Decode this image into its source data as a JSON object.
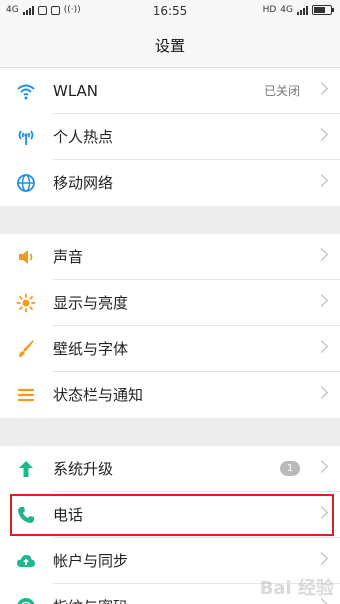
{
  "status_bar": {
    "network_left": "4G",
    "time": "16:55",
    "network_right_hd": "HD",
    "network_right_4g": "4G",
    "battery_level": 0.7
  },
  "header": {
    "title": "设置"
  },
  "groups": [
    {
      "items": [
        {
          "name": "wlan",
          "label": "WLAN",
          "icon": "wifi-icon",
          "color": "#1e90e6",
          "value": "已关闭"
        },
        {
          "name": "hotspot",
          "label": "个人热点",
          "icon": "hotspot-icon",
          "color": "#1e90e6"
        },
        {
          "name": "mobile-network",
          "label": "移动网络",
          "icon": "globe-icon",
          "color": "#1e90e6"
        }
      ]
    },
    {
      "items": [
        {
          "name": "sound",
          "label": "声音",
          "icon": "speaker-icon",
          "color": "#f39a1e"
        },
        {
          "name": "display",
          "label": "显示与亮度",
          "icon": "sun-icon",
          "color": "#f39a1e"
        },
        {
          "name": "wallpaper",
          "label": "壁纸与字体",
          "icon": "brush-icon",
          "color": "#f39a1e"
        },
        {
          "name": "statusbar",
          "label": "状态栏与通知",
          "icon": "menu-lines-icon",
          "color": "#f39a1e"
        }
      ]
    },
    {
      "items": [
        {
          "name": "system-update",
          "label": "系统升级",
          "icon": "arrow-up-icon",
          "color": "#1fb58f",
          "badge": "1"
        },
        {
          "name": "phone",
          "label": "电话",
          "icon": "phone-icon",
          "color": "#1fb58f",
          "highlight": true
        },
        {
          "name": "account-sync",
          "label": "帐户与同步",
          "icon": "cloud-sync-icon",
          "color": "#1fb58f"
        },
        {
          "name": "fingerprint",
          "label": "指纹与密码",
          "icon": "fingerprint-icon",
          "color": "#1fb58f"
        }
      ]
    }
  ],
  "watermark": "Bai 经验"
}
